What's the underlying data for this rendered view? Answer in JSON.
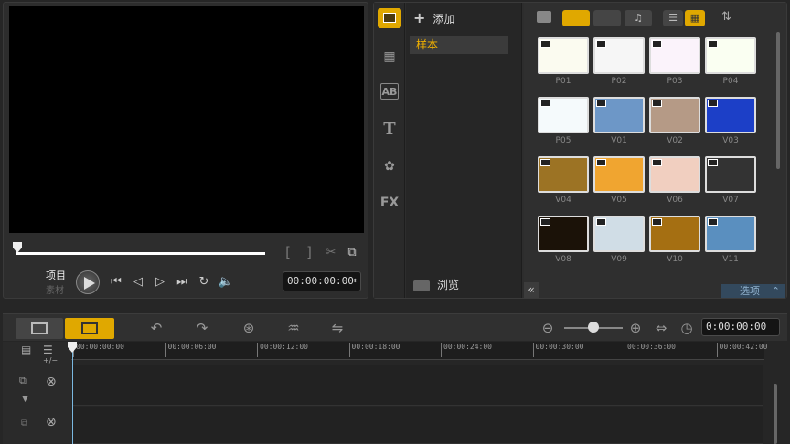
{
  "preview": {
    "mode_project": "项目",
    "mode_clip": "素材",
    "mark_in": "[",
    "mark_out": "]",
    "timecode": "00:00:00:00"
  },
  "library": {
    "add_label": "添加",
    "folder_sample": "样本",
    "browse_label": "浏览",
    "options_label": "选项",
    "side_text_ab": "AB",
    "side_text_t": "T",
    "side_text_fx": "FX",
    "thumbnails": [
      {
        "label": "P01",
        "bg": "#fbfbf0"
      },
      {
        "label": "P02",
        "bg": "#f6f6f6"
      },
      {
        "label": "P03",
        "bg": "#fbf3fb"
      },
      {
        "label": "P04",
        "bg": "#fafff2"
      },
      {
        "label": "P05",
        "bg": "#f5fafc"
      },
      {
        "label": "V01",
        "bg": "#6d97c7"
      },
      {
        "label": "V02",
        "bg": "#b59a86"
      },
      {
        "label": "V03",
        "bg": "#1c3fc7"
      },
      {
        "label": "V04",
        "bg": "#9c7324"
      },
      {
        "label": "V05",
        "bg": "#f0a530"
      },
      {
        "label": "V06",
        "bg": "#f1cfc0"
      },
      {
        "label": "V07",
        "bg": "#333333"
      },
      {
        "label": "V08",
        "bg": "#1b1208"
      },
      {
        "label": "V09",
        "bg": "#d0dde6"
      },
      {
        "label": "V10",
        "bg": "#a56f12"
      },
      {
        "label": "V11",
        "bg": "#5a8fbf"
      }
    ]
  },
  "timeline": {
    "timecode": "0:00:00:00",
    "track_add_label": "+/−",
    "ruler_ticks": [
      "00:00:00:00",
      "00:00:06:00",
      "00:00:12:00",
      "00:00:18:00",
      "00:00:24:00",
      "00:00:30:00",
      "00:00:36:00",
      "00:00:42:00"
    ]
  },
  "colors": {
    "accent": "#e0a800",
    "panel": "#2d2d2d",
    "playhead": "#7ab8e0"
  }
}
